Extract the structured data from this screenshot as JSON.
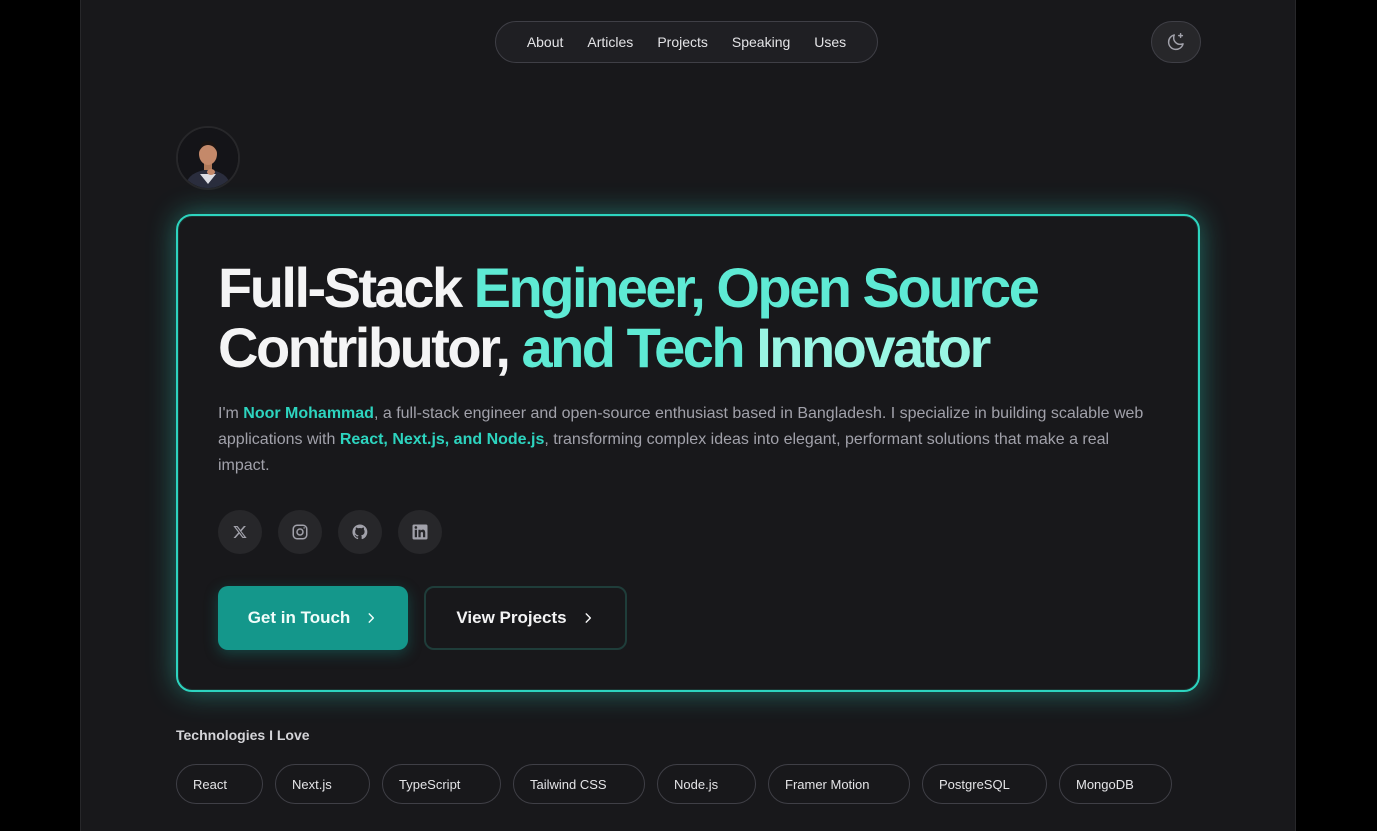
{
  "nav": {
    "items": [
      {
        "label": "About"
      },
      {
        "label": "Articles"
      },
      {
        "label": "Projects"
      },
      {
        "label": "Speaking"
      },
      {
        "label": "Uses"
      }
    ],
    "theme_toggle_icon": "moon-sparkle-icon"
  },
  "avatar": {
    "icon": "profile-photo"
  },
  "hero": {
    "headline_part1": "Full-Stack ",
    "headline_part2": "Engineer, Open Source",
    "headline_part3": "Contributor, ",
    "headline_part4": "and Tech ",
    "headline_part5": "Innovator",
    "intro_prefix": "I'm ",
    "intro_name": "Noor Mohammad",
    "intro_mid": ", a full-stack engineer and open-source enthusiast based in Bangladesh. I specialize in building scalable web applications with ",
    "intro_stack": "React, Next.js, and Node.js",
    "intro_suffix": ", transforming complex ideas into elegant, performant solutions that make a real impact.",
    "socials": [
      {
        "icon": "x-icon"
      },
      {
        "icon": "instagram-icon"
      },
      {
        "icon": "github-icon"
      },
      {
        "icon": "linkedin-icon"
      }
    ],
    "primary_button": "Get in Touch",
    "secondary_button": "View Projects"
  },
  "technologies": {
    "title": "Technologies I Love",
    "items": [
      "React",
      "Next.js",
      "TypeScript",
      "Tailwind CSS",
      "Node.js",
      "Framer Motion",
      "PostgreSQL",
      "MongoDB"
    ]
  },
  "colors": {
    "accent": "#2dd4bf",
    "accent_light": "#5eead4",
    "background": "#18181b",
    "button_primary": "#14978b"
  }
}
